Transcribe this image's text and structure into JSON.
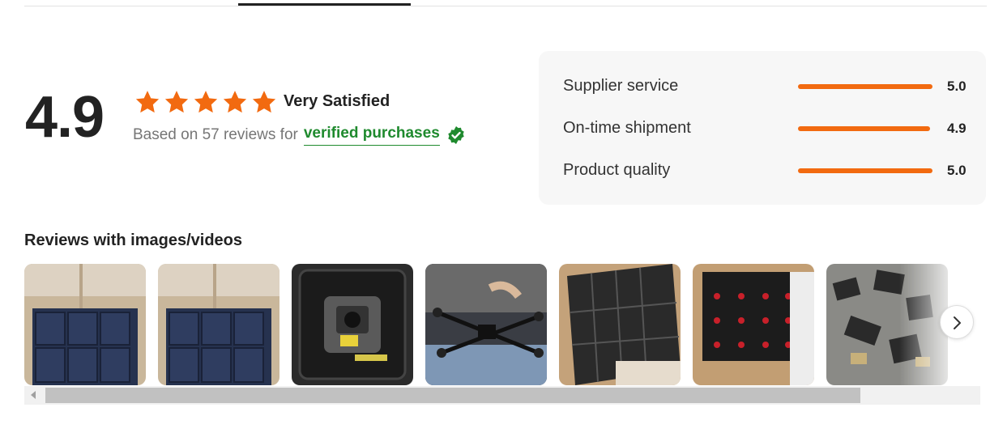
{
  "summary": {
    "rating": "4.9",
    "stars": 5,
    "sentiment": "Very Satisfied",
    "based_on": "Based on 57 reviews for",
    "verified_label": "verified purchases"
  },
  "metrics": [
    {
      "label": "Supplier service",
      "value": "5.0",
      "score": 5.0
    },
    {
      "label": "On-time shipment",
      "value": "4.9",
      "score": 4.9
    },
    {
      "label": "Product quality",
      "value": "5.0",
      "score": 5.0
    }
  ],
  "gallery": {
    "title": "Reviews with images/videos",
    "images": [
      "review-photo-packed-boxes",
      "review-photo-packed-boxes",
      "review-photo-gimbal-in-case",
      "review-photo-drone-frame",
      "review-photo-box-of-black-packages",
      "review-photo-box-of-labeled-packages",
      "review-photo-parts-pile"
    ]
  },
  "colors": {
    "accent": "#f26a10",
    "verified": "#1f8a2e",
    "star": "#f26a10"
  },
  "icons": {
    "star": "star-icon",
    "verified": "verified-badge-icon",
    "next": "chevron-right-icon",
    "scroll_left": "scroll-left-arrow-icon"
  }
}
